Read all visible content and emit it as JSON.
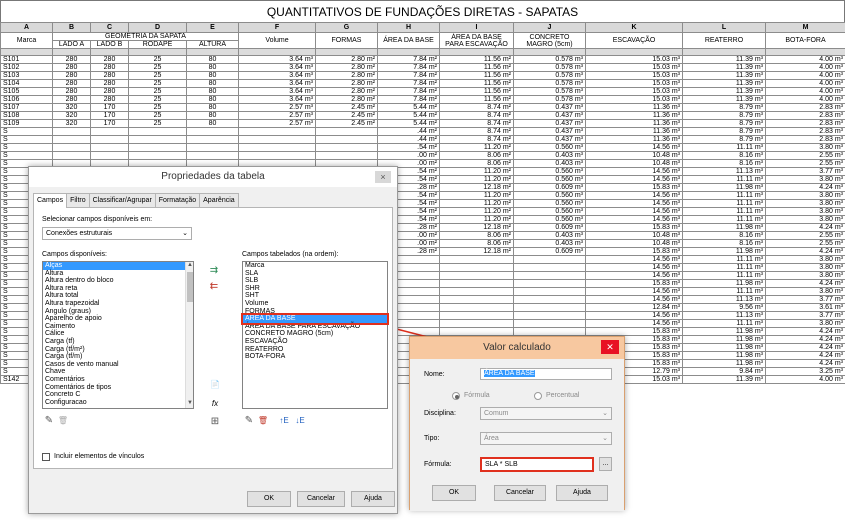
{
  "sheet": {
    "title": "QUANTITATIVOS DE FUNDAÇÕES DIRETAS - SAPATAS",
    "letters": [
      "A",
      "B",
      "C",
      "D",
      "E",
      "F",
      "G",
      "H",
      "I",
      "J",
      "K",
      "L",
      "M"
    ],
    "group_header": "GEOMETRIA DA SAPATA",
    "headers": {
      "marca": "Marca",
      "lado_a": "LADO A",
      "lado_b": "LADO B",
      "rodape": "RODAPÉ",
      "altura": "ALTURA",
      "volume": "Volume",
      "formas": "FORMAS",
      "area_base": "ÁREA DA BASE",
      "area_escav": "ÁREA DA BASE PARA ESCAVAÇÃO",
      "concreto": "CONCRETO MAGRO (5cm)",
      "escavacao": "ESCAVAÇÃO",
      "reaterro": "REATERRO",
      "bota_fora": "BOTA-FORA"
    },
    "rows": [
      [
        "S101",
        "280",
        "280",
        "25",
        "80",
        "3.64 m³",
        "2.80 m²",
        "7.84 m²",
        "11.56 m²",
        "0.578 m³",
        "15.03 m³",
        "11.39 m³",
        "4.00 m³"
      ],
      [
        "S102",
        "280",
        "280",
        "25",
        "80",
        "3.64 m³",
        "2.80 m²",
        "7.84 m²",
        "11.56 m²",
        "0.578 m³",
        "15.03 m³",
        "11.39 m³",
        "4.00 m³"
      ],
      [
        "S103",
        "280",
        "280",
        "25",
        "80",
        "3.64 m³",
        "2.80 m²",
        "7.84 m²",
        "11.56 m²",
        "0.578 m³",
        "15.03 m³",
        "11.39 m³",
        "4.00 m³"
      ],
      [
        "S104",
        "280",
        "280",
        "25",
        "80",
        "3.64 m³",
        "2.80 m²",
        "7.84 m²",
        "11.56 m²",
        "0.578 m³",
        "15.03 m³",
        "11.39 m³",
        "4.00 m³"
      ],
      [
        "S105",
        "280",
        "280",
        "25",
        "80",
        "3.64 m³",
        "2.80 m²",
        "7.84 m²",
        "11.56 m²",
        "0.578 m³",
        "15.03 m³",
        "11.39 m³",
        "4.00 m³"
      ],
      [
        "S106",
        "280",
        "280",
        "25",
        "80",
        "3.64 m³",
        "2.80 m²",
        "7.84 m²",
        "11.56 m²",
        "0.578 m³",
        "15.03 m³",
        "11.39 m³",
        "4.00 m³"
      ],
      [
        "S107",
        "320",
        "170",
        "25",
        "80",
        "2.57 m³",
        "2.45 m²",
        "5.44 m²",
        "8.74 m²",
        "0.437 m³",
        "11.36 m³",
        "8.79 m³",
        "2.83 m³"
      ],
      [
        "S108",
        "320",
        "170",
        "25",
        "80",
        "2.57 m³",
        "2.45 m²",
        "5.44 m²",
        "8.74 m²",
        "0.437 m³",
        "11.36 m³",
        "8.79 m³",
        "2.83 m³"
      ],
      [
        "S109",
        "320",
        "170",
        "25",
        "80",
        "2.57 m³",
        "2.45 m²",
        "5.44 m²",
        "8.74 m²",
        "0.437 m³",
        "11.36 m³",
        "8.79 m³",
        "2.83 m³"
      ],
      [
        "S",
        "",
        "",
        "",
        "",
        "",
        "",
        ".44 m²",
        "8.74 m²",
        "0.437 m³",
        "11.36 m³",
        "8.79 m³",
        "2.83 m³"
      ],
      [
        "S",
        "",
        "",
        "",
        "",
        "",
        "",
        ".44 m²",
        "8.74 m²",
        "0.437 m³",
        "11.36 m³",
        "8.79 m³",
        "2.83 m³"
      ],
      [
        "S",
        "",
        "",
        "",
        "",
        "",
        "",
        ".54 m²",
        "11.20 m²",
        "0.560 m³",
        "14.56 m³",
        "11.11 m³",
        "3.80 m³"
      ],
      [
        "S",
        "",
        "",
        "",
        "",
        "",
        "",
        ".00 m²",
        "8.06 m²",
        "0.403 m³",
        "10.48 m³",
        "8.16 m³",
        "2.55 m³"
      ],
      [
        "S",
        "",
        "",
        "",
        "",
        "",
        "",
        ".00 m²",
        "8.06 m²",
        "0.403 m³",
        "10.48 m³",
        "8.16 m³",
        "2.55 m³"
      ],
      [
        "S",
        "",
        "",
        "",
        "",
        "",
        "",
        ".54 m²",
        "11.20 m²",
        "0.560 m³",
        "14.56 m³",
        "11.13 m³",
        "3.77 m³"
      ],
      [
        "S",
        "",
        "",
        "",
        "",
        "",
        "",
        ".54 m²",
        "11.20 m²",
        "0.560 m³",
        "14.56 m³",
        "11.11 m³",
        "3.80 m³"
      ],
      [
        "S",
        "",
        "",
        "",
        "",
        "",
        "",
        ".28 m²",
        "12.18 m²",
        "0.609 m³",
        "15.83 m³",
        "11.98 m³",
        "4.24 m³"
      ],
      [
        "S",
        "",
        "",
        "",
        "",
        "",
        "",
        ".54 m²",
        "11.20 m²",
        "0.560 m³",
        "14.56 m³",
        "11.11 m³",
        "3.80 m³"
      ],
      [
        "S",
        "",
        "",
        "",
        "",
        "",
        "",
        ".54 m²",
        "11.20 m²",
        "0.560 m³",
        "14.56 m³",
        "11.11 m³",
        "3.80 m³"
      ],
      [
        "S",
        "",
        "",
        "",
        "",
        "",
        "",
        ".54 m²",
        "11.20 m²",
        "0.560 m³",
        "14.56 m³",
        "11.11 m³",
        "3.80 m³"
      ],
      [
        "S",
        "",
        "",
        "",
        "",
        "",
        "",
        ".54 m²",
        "11.20 m²",
        "0.560 m³",
        "14.56 m³",
        "11.11 m³",
        "3.80 m³"
      ],
      [
        "S",
        "",
        "",
        "",
        "",
        "",
        "",
        ".28 m²",
        "12.18 m²",
        "0.609 m³",
        "15.83 m³",
        "11.98 m³",
        "4.24 m³"
      ],
      [
        "S",
        "",
        "",
        "",
        "",
        "",
        "",
        ".00 m²",
        "8.06 m²",
        "0.403 m³",
        "10.48 m³",
        "8.16 m³",
        "2.55 m³"
      ],
      [
        "S",
        "",
        "",
        "",
        "",
        "",
        "",
        ".00 m²",
        "8.06 m²",
        "0.403 m³",
        "10.48 m³",
        "8.16 m³",
        "2.55 m³"
      ],
      [
        "S",
        "",
        "",
        "",
        "",
        "",
        "",
        ".28 m²",
        "12.18 m²",
        "0.609 m³",
        "15.83 m³",
        "11.98 m³",
        "4.24 m³"
      ],
      [
        "S",
        "",
        "",
        "",
        "",
        "",
        "",
        "",
        "",
        "",
        "14.56 m³",
        "11.11 m³",
        "3.80 m³"
      ],
      [
        "S",
        "",
        "",
        "",
        "",
        "",
        "",
        "",
        "",
        "",
        "14.56 m³",
        "11.11 m³",
        "3.80 m³"
      ],
      [
        "S",
        "",
        "",
        "",
        "",
        "",
        "",
        "",
        "",
        "",
        "14.56 m³",
        "11.11 m³",
        "3.80 m³"
      ],
      [
        "S",
        "",
        "",
        "",
        "",
        "",
        "",
        "",
        "",
        "",
        "15.83 m³",
        "11.98 m³",
        "4.24 m³"
      ],
      [
        "S",
        "",
        "",
        "",
        "",
        "",
        "",
        "",
        "",
        "",
        "14.56 m³",
        "11.11 m³",
        "3.80 m³"
      ],
      [
        "S",
        "",
        "",
        "",
        "",
        "",
        "",
        "",
        "",
        "",
        "14.56 m³",
        "11.13 m³",
        "3.77 m³"
      ],
      [
        "S",
        "",
        "",
        "",
        "",
        "",
        "",
        "",
        "",
        "",
        "12.84 m³",
        "9.56 m³",
        "3.61 m³"
      ],
      [
        "S",
        "",
        "",
        "",
        "",
        "",
        "",
        "",
        "",
        "",
        "14.56 m³",
        "11.13 m³",
        "3.77 m³"
      ],
      [
        "S",
        "",
        "",
        "",
        "",
        "",
        "",
        "",
        "",
        "",
        "14.56 m³",
        "11.11 m³",
        "3.80 m³"
      ],
      [
        "S",
        "",
        "",
        "",
        "",
        "",
        "",
        "",
        "",
        "",
        "15.83 m³",
        "11.98 m³",
        "4.24 m³"
      ],
      [
        "S",
        "",
        "",
        "",
        "",
        "",
        "",
        "",
        "",
        "",
        "15.83 m³",
        "11.98 m³",
        "4.24 m³"
      ],
      [
        "S",
        "",
        "",
        "",
        "",
        "",
        "",
        "",
        "",
        "",
        "15.83 m³",
        "11.98 m³",
        "4.24 m³"
      ],
      [
        "S",
        "",
        "",
        "",
        "",
        "",
        "",
        "",
        "",
        "",
        "15.83 m³",
        "11.98 m³",
        "4.24 m³"
      ],
      [
        "S",
        "",
        "",
        "",
        "",
        "",
        "",
        "",
        "",
        "",
        "15.83 m³",
        "11.98 m³",
        "4.24 m³"
      ],
      [
        "S",
        "",
        "",
        "",
        "",
        "",
        "",
        "",
        "",
        "",
        "12.79 m³",
        "9.84 m³",
        "3.25 m³"
      ]
    ],
    "last_row": [
      "S142",
      "280",
      "280",
      "25",
      "80",
      "3.64 m³",
      "2.80 m²",
      "7.84 m²",
      "11.56 m²",
      "0.578 m³",
      "15.03 m³",
      "11.39 m³",
      "4.00 m³"
    ]
  },
  "props_dialog": {
    "title": "Propriedades da tabela",
    "close_glyph": "×",
    "tabs": [
      "Campos",
      "Filtro",
      "Classificar/Agrupar",
      "Formatação",
      "Aparência"
    ],
    "select_label": "Selecionar campos disponíveis em:",
    "select_value": "Conexões estruturais",
    "available_label": "Campos disponíveis:",
    "available": [
      "Alças",
      "Altura",
      "Altura dentro do bloco",
      "Altura reta",
      "Altura total",
      "Altura trapezoidal",
      "Angulo (graus)",
      "Aparelho de apoio",
      "Caimento",
      "Cálice",
      "Carga (tf)",
      "Carga (tf/m²)",
      "Carga (tf/m)",
      "Casos de vento manual",
      "Chave",
      "Comentários",
      "Comentários de tipos",
      "Concreto C",
      "Configuracao"
    ],
    "scheduled_label": "Campos tabelados (na ordem):",
    "scheduled": [
      "Marca",
      "SLA",
      "SLB",
      "SHR",
      "SHT",
      "Volume",
      "FORMAS",
      "ÁREA DA BASE",
      "ÁREA DA BASE PARA ESCAVAÇÃO",
      "CONCRETO MAGRO (5cm)",
      "ESCAVAÇÃO",
      "REATERRO",
      "BOTA-FORA"
    ],
    "selected_index": 7,
    "include_links": "Incluir elementos de vínculos",
    "ok": "OK",
    "cancel": "Cancelar",
    "help": "Ajuda",
    "add_glyph": "⇉",
    "remove_glyph": "⇇",
    "new_param_glyph": "📄",
    "fx_glyph": "fx",
    "combine_glyph": "⊞",
    "edit_glyph": "✎",
    "delete_glyph": "🗑",
    "up_glyph": "↑E",
    "down_glyph": "↓E"
  },
  "calc_dialog": {
    "title": "Valor calculado",
    "close_glyph": "✕",
    "name_label": "Nome:",
    "name_value": "ÁREA DA BASE",
    "formula_option": "Fórmula",
    "percent_option": "Percentual",
    "discipline_label": "Disciplina:",
    "discipline_value": "Comum",
    "type_label": "Tipo:",
    "type_value": "Área",
    "formula_label": "Fórmula:",
    "formula_value": "SLA * SLB",
    "ellipsis": "...",
    "ok": "OK",
    "cancel": "Cancelar",
    "help": "Ajuda"
  }
}
